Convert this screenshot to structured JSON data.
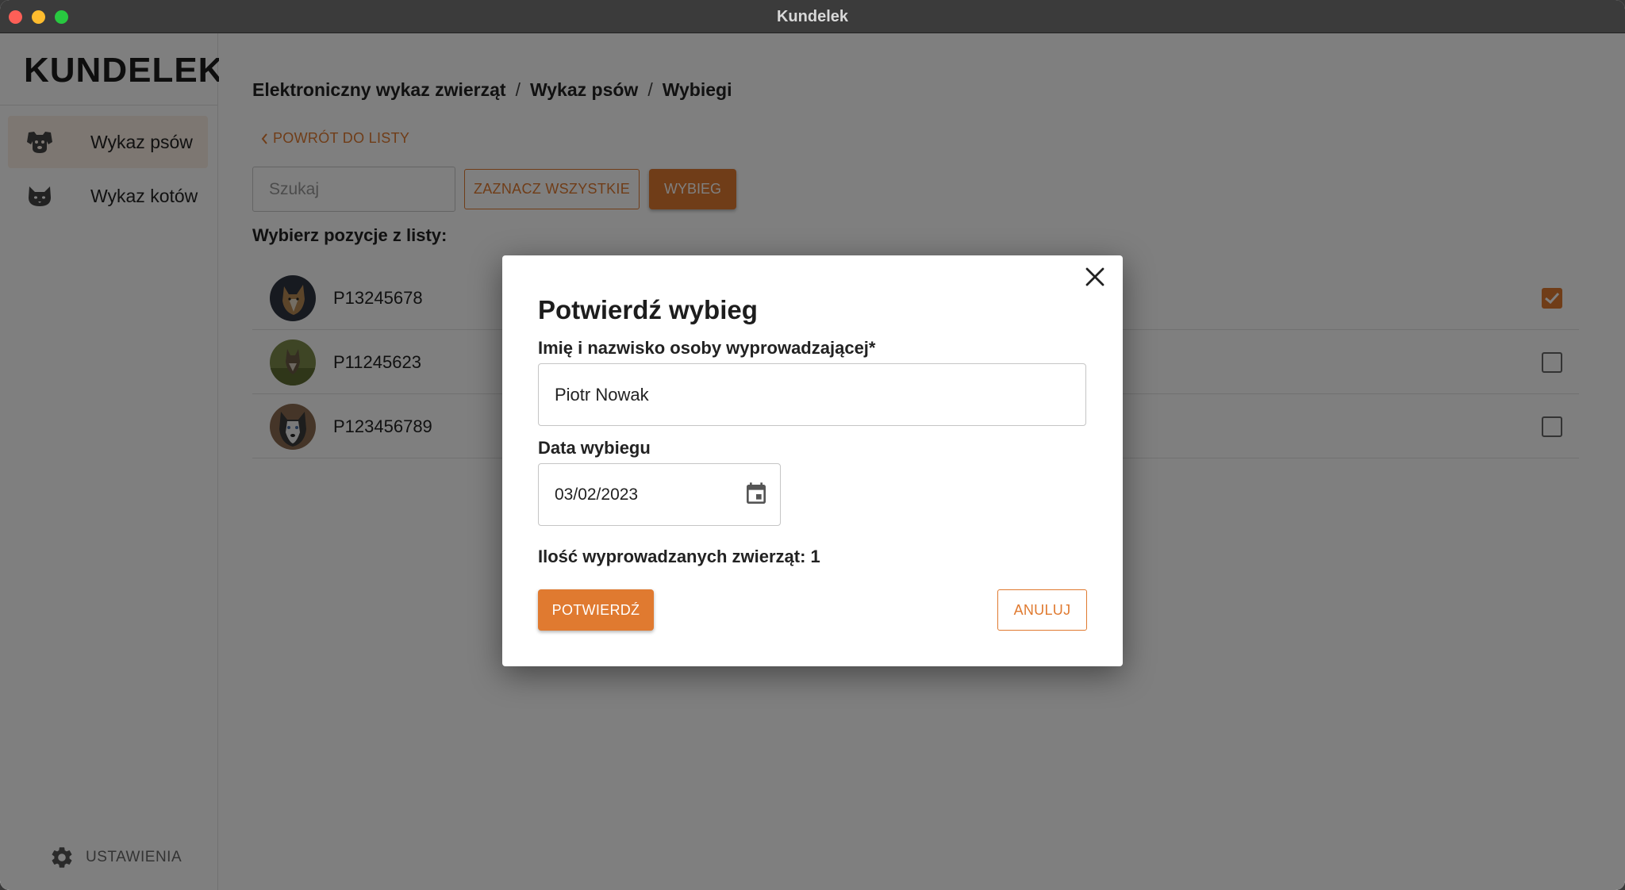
{
  "window": {
    "title": "Kundelek"
  },
  "sidebar": {
    "logo": "KUNDELEK",
    "items": [
      {
        "label": "Wykaz psów",
        "icon": "dog-icon",
        "active": true
      },
      {
        "label": "Wykaz kotów",
        "icon": "cat-icon",
        "active": false
      }
    ],
    "settings_label": "USTAWIENIA"
  },
  "breadcrumb": {
    "items": [
      "Elektroniczny wykaz zwierząt",
      "Wykaz psów",
      "Wybiegi"
    ],
    "separator": "/"
  },
  "toolbar": {
    "back_label": "POWRÓT DO LISTY",
    "search_placeholder": "Szukaj",
    "select_all_label": "ZAZNACZ WSZYSTKIE",
    "walk_label": "WYBIEG"
  },
  "list": {
    "title": "Wybierz pozycje z listy:",
    "rows": [
      {
        "code": "P13245678",
        "checked": true
      },
      {
        "code": "P11245623",
        "checked": false
      },
      {
        "code": "P123456789",
        "checked": false
      }
    ]
  },
  "modal": {
    "title": "Potwierdź wybieg",
    "name_label": "Imię i nazwisko osoby wyprowadzającej*",
    "name_value": "Piotr Nowak",
    "date_label": "Data wybiegu",
    "date_value": "03/02/2023",
    "count_text": "Ilość wyprowadzanych zwierząt: 1",
    "confirm_label": "POTWIERDŹ",
    "cancel_label": "ANULUJ"
  },
  "colors": {
    "accent": "#e07a30",
    "active_nav_bg": "#fbeee4"
  }
}
